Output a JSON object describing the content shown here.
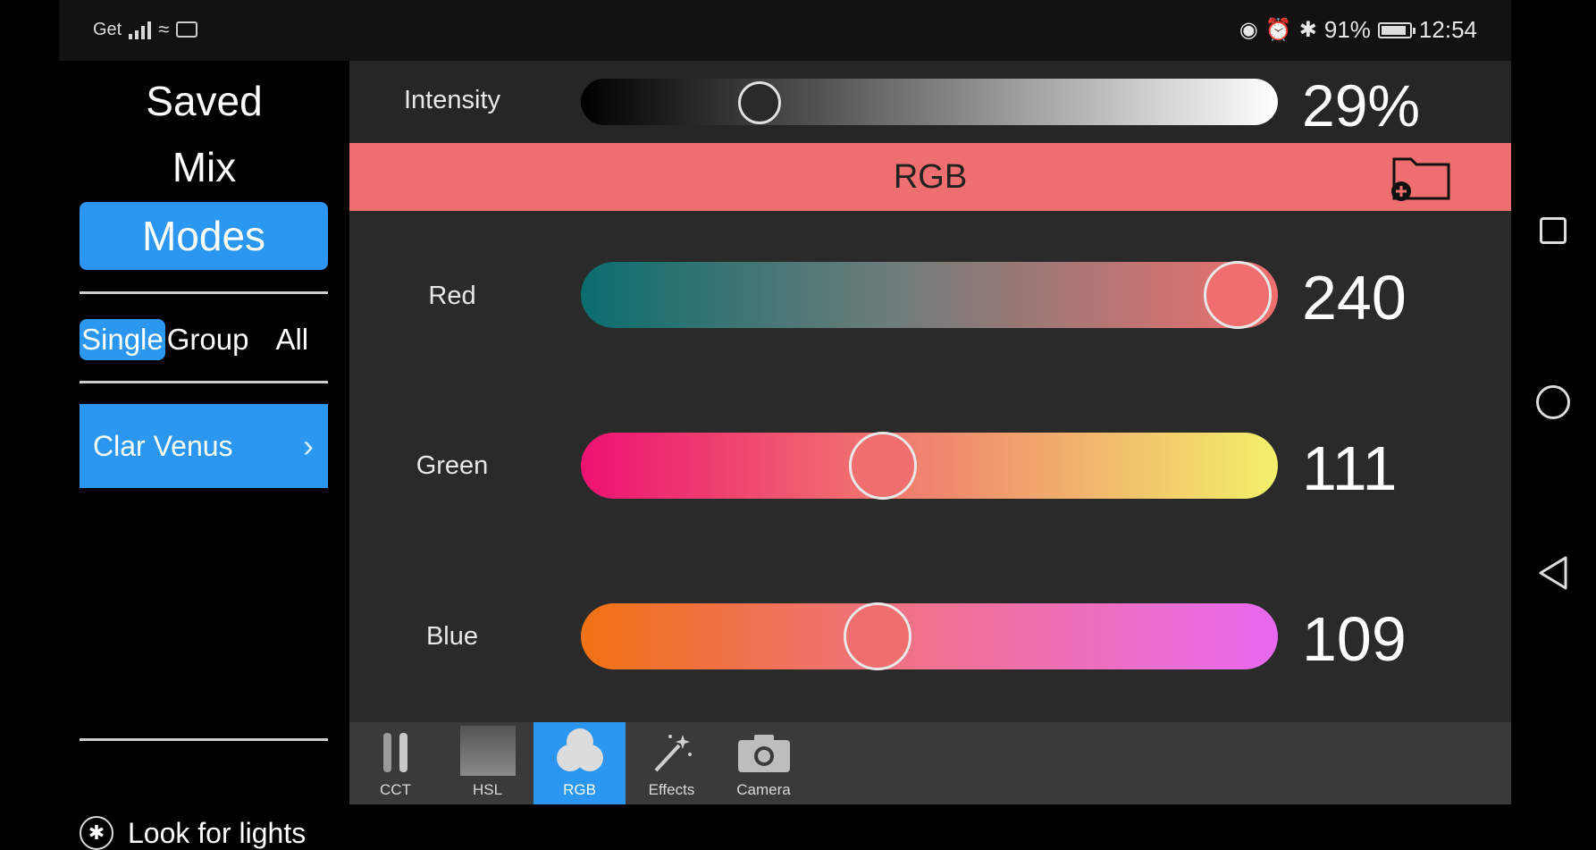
{
  "status_bar": {
    "carrier": "Get",
    "battery_text": "91%",
    "battery_level": 0.91,
    "time": "12:54"
  },
  "sidebar": {
    "saved_label": "Saved",
    "mix_label": "Mix",
    "modes_label": "Modes",
    "scope": {
      "single": "Single",
      "group": "Group",
      "all": "All",
      "selected": "Single"
    },
    "device_name": "Clar Venus",
    "look_for_lights": "Look for lights"
  },
  "intensity": {
    "label": "Intensity",
    "value_text": "29%",
    "value": 29
  },
  "mode_bar": {
    "title": "RGB",
    "accent": "#ef6e6f"
  },
  "channels": [
    {
      "label": "Red",
      "value": 240,
      "value_text": "240"
    },
    {
      "label": "Green",
      "value": 111,
      "value_text": "111"
    },
    {
      "label": "Blue",
      "value": 109,
      "value_text": "109"
    }
  ],
  "channel_max": 255,
  "toolbar": {
    "items": [
      {
        "label": "CCT",
        "icon": "cct-tubes-icon"
      },
      {
        "label": "HSL",
        "icon": "hsl-gradient-icon"
      },
      {
        "label": "RGB",
        "icon": "rgb-circles-icon"
      },
      {
        "label": "Effects",
        "icon": "magic-wand-icon"
      },
      {
        "label": "Camera",
        "icon": "camera-icon"
      }
    ],
    "active": "RGB"
  },
  "colors": {
    "accent_blue": "#2b97f0",
    "panel": "#2a2a2a"
  }
}
